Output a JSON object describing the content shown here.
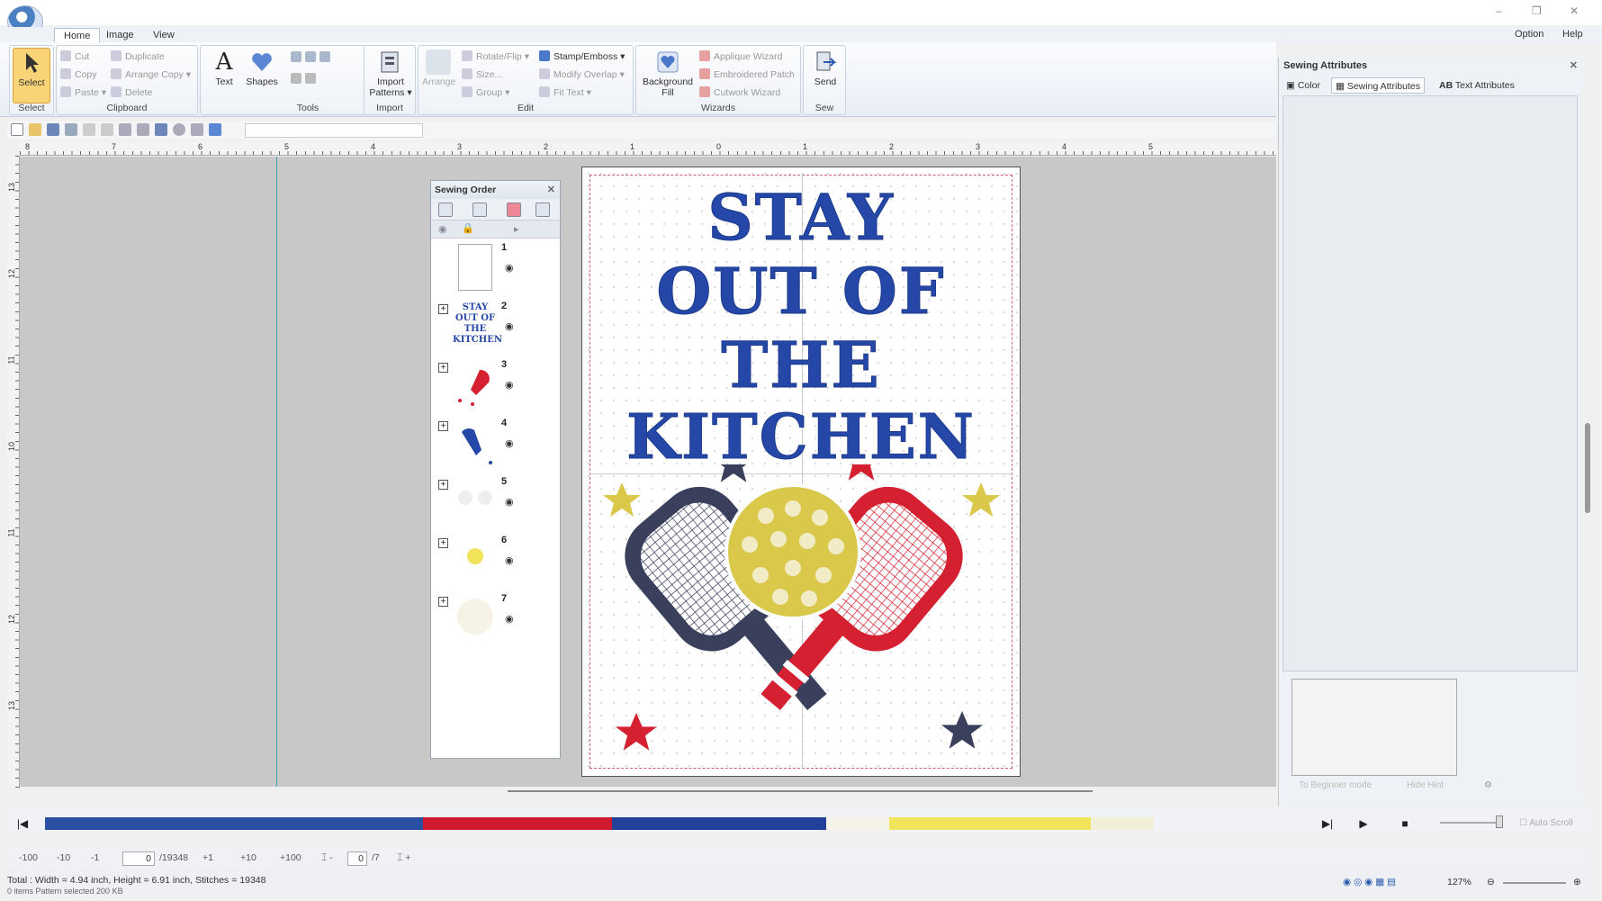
{
  "menu": {
    "tabs": [
      "Home",
      "Image",
      "View"
    ],
    "right": [
      "Option",
      "Help"
    ]
  },
  "ribbon": {
    "select": {
      "label": "Select",
      "group": "Select"
    },
    "clipboard": {
      "group": "Clipboard",
      "cut": "Cut",
      "copy": "Copy",
      "paste": "Paste",
      "duplicate": "Duplicate",
      "arrange_copy": "Arrange Copy",
      "delete": "Delete"
    },
    "tools": {
      "group": "Tools",
      "text": "Text",
      "shapes": "Shapes"
    },
    "import": {
      "group": "Import",
      "import_patterns": "Import Patterns"
    },
    "edit": {
      "group": "Edit",
      "arrange": "Arrange",
      "rotate_flip": "Rotate/Flip",
      "size": "Size...",
      "group_btn": "Group",
      "stamp_emboss": "Stamp/Emboss",
      "modify_overlap": "Modify Overlap",
      "fit_text": "Fit Text"
    },
    "wizards": {
      "group": "Wizards",
      "background_fill": "Background Fill",
      "applique_wizard": "Applique Wizard",
      "embroidered_patch": "Embroidered Patch",
      "cutwork_wizard": "Cutwork Wizard"
    },
    "sew": {
      "group": "Sew",
      "send": "Send"
    }
  },
  "rulers": {
    "h_ticks": [
      "8",
      "7",
      "6",
      "5",
      "4",
      "3",
      "2",
      "1",
      "0",
      "1",
      "2",
      "3",
      "4",
      "5"
    ],
    "v_ticks": [
      "13",
      "12",
      "11",
      "10",
      "11",
      "12",
      "13"
    ]
  },
  "sewing_order": {
    "title": "Sewing Order",
    "items": [
      {
        "num": "1",
        "thumb": "blank-thumb"
      },
      {
        "num": "2",
        "thumb": "text-thumb",
        "text": "STAY OUT OF THE KITCHEN"
      },
      {
        "num": "3",
        "thumb": "red-paddle-thumb"
      },
      {
        "num": "4",
        "thumb": "blue-paddle-thumb"
      },
      {
        "num": "5",
        "thumb": "white-stitch-thumb"
      },
      {
        "num": "6",
        "thumb": "yellow-ball-thumb"
      },
      {
        "num": "7",
        "thumb": "ball-holes-thumb"
      }
    ]
  },
  "design": {
    "lines": [
      "STAY",
      "OUT OF",
      "THE",
      "KITCHEN"
    ],
    "colors": {
      "blue": "#2547a8",
      "navy": "#3a3f5c",
      "red": "#d42030",
      "gold": "#d9c84a"
    }
  },
  "attributes": {
    "title": "Sewing Attributes",
    "tabs": [
      "Color",
      "Sewing Attributes",
      "Text Attributes"
    ],
    "tab_icon_text": "AB",
    "buttons": [
      "To Beginner mode",
      "Hide Hint"
    ]
  },
  "colorbar": [
    {
      "color": "#2a4fa3",
      "share": 0.3
    },
    {
      "color": "#d01a30",
      "share": 0.15
    },
    {
      "color": "#223f9a",
      "share": 0.17
    },
    {
      "color": "#f5f3e8",
      "share": 0.05
    },
    {
      "color": "#f1e35a",
      "share": 0.16
    },
    {
      "color": "#f3f0da",
      "share": 0.05
    }
  ],
  "controls": {
    "steps": [
      "-100",
      "-10",
      "-1",
      "+1",
      "+10",
      "+100"
    ],
    "stitch_pos": "0",
    "stitch_total": "/19348",
    "color_pos": "0",
    "color_total": "/7",
    "auto_scroll": "Auto Scroll"
  },
  "status": {
    "summary": "Total : Width = 4.94 inch, Height = 6.91 inch, Stitches = 19348",
    "selection": "0 items    Pattern selected    200 KB",
    "zoom": "127%"
  }
}
